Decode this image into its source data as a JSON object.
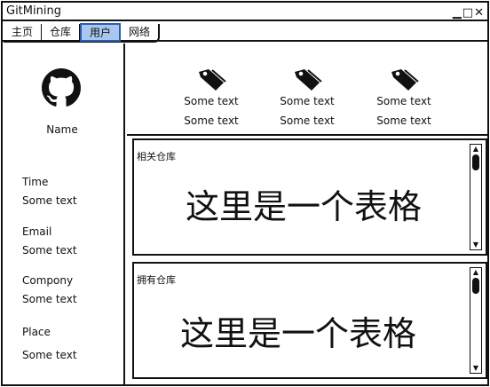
{
  "window": {
    "title": "GitMining"
  },
  "tabs": [
    {
      "label": "主页"
    },
    {
      "label": "仓库"
    },
    {
      "label": "用户",
      "active": true
    },
    {
      "label": "网络"
    }
  ],
  "profile": {
    "name": "Name",
    "fields": [
      {
        "label": "Time",
        "value": "Some text"
      },
      {
        "label": "Email",
        "value": "Some text"
      },
      {
        "label": "Compony",
        "value": "Some text"
      },
      {
        "label": "Place",
        "value": "Some text"
      }
    ]
  },
  "stats": [
    {
      "icon": "tag-icon",
      "line1": "Some text",
      "line2": "Some text"
    },
    {
      "icon": "tag-icon",
      "line1": "Some text",
      "line2": "Some text"
    },
    {
      "icon": "tag-icon",
      "line1": "Some text",
      "line2": "Some text"
    }
  ],
  "panels": [
    {
      "label": "相关仓库",
      "body": "这里是一个表格"
    },
    {
      "label": "拥有仓库",
      "body": "这里是一个表格"
    }
  ],
  "colors": {
    "active_tab_bg": "#a9c6ef",
    "active_tab_border": "#2a5db0"
  }
}
